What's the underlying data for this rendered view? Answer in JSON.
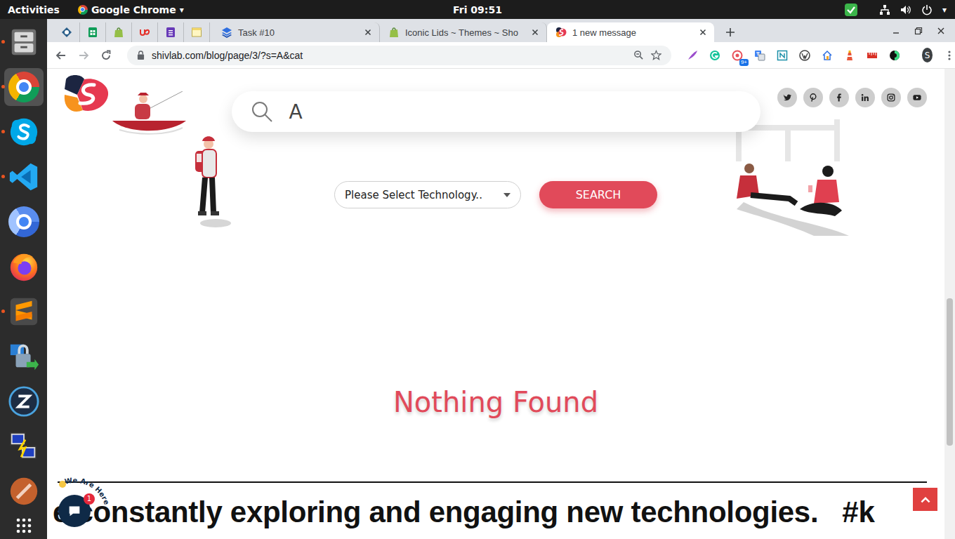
{
  "topbar": {
    "activities": "Activities",
    "app": "Google Chrome",
    "app_caret": "▾",
    "clock": "Fri 09:51",
    "power_caret": "▾"
  },
  "dock": [
    {
      "kind": "files",
      "running": true,
      "selected": false
    },
    {
      "kind": "chrome",
      "running": true,
      "selected": true
    },
    {
      "kind": "skype",
      "running": true,
      "selected": false
    },
    {
      "kind": "vscode",
      "running": true,
      "selected": false
    },
    {
      "kind": "chromium",
      "running": false,
      "selected": false
    },
    {
      "kind": "firefox",
      "running": false,
      "selected": false
    },
    {
      "kind": "sublime",
      "running": true,
      "selected": false
    },
    {
      "kind": "vpn",
      "running": false,
      "selected": false
    },
    {
      "kind": "anydesk",
      "running": false,
      "selected": false
    },
    {
      "kind": "putty",
      "running": false,
      "selected": false
    },
    {
      "kind": "postman",
      "running": false,
      "selected": false
    }
  ],
  "browser": {
    "pinned_tabs": [
      {
        "kind": "generic"
      },
      {
        "kind": "sheets"
      },
      {
        "kind": "shopify"
      },
      {
        "kind": "upwork"
      },
      {
        "kind": "forms"
      },
      {
        "kind": "notes"
      }
    ],
    "tabs": [
      {
        "kind": "layers",
        "label": "Task #10",
        "selected": false
      },
      {
        "kind": "shopify",
        "label": "Iconic Lids ~ Themes ~ Sho",
        "selected": false
      },
      {
        "kind": "shivlab",
        "label": "1 new message",
        "selected": true
      }
    ],
    "url": "shivlab.com/blog/page/3/?s=A&cat",
    "extensions": [
      {
        "kind": "quill"
      },
      {
        "kind": "grammarly"
      },
      {
        "kind": "tracker",
        "badge": "9+"
      },
      {
        "kind": "translate"
      },
      {
        "kind": "notion"
      },
      {
        "kind": "wordpress"
      },
      {
        "kind": "home"
      },
      {
        "kind": "lighthouse"
      },
      {
        "kind": "ruler"
      },
      {
        "kind": "dark"
      }
    ],
    "profile": "S"
  },
  "page": {
    "search_value": "A",
    "select": "Please Select Technology..",
    "button": "SEARCH",
    "message": "Nothing Found",
    "marquee": "e constantly exploring and engaging new technologies.   #k",
    "socials": [
      {
        "kind": "twitter"
      },
      {
        "kind": "pinterest"
      },
      {
        "kind": "facebook"
      },
      {
        "kind": "linkedin"
      },
      {
        "kind": "instagram"
      },
      {
        "kind": "youtube"
      }
    ],
    "chat": {
      "label": "We Are Here",
      "badge": "1"
    }
  }
}
